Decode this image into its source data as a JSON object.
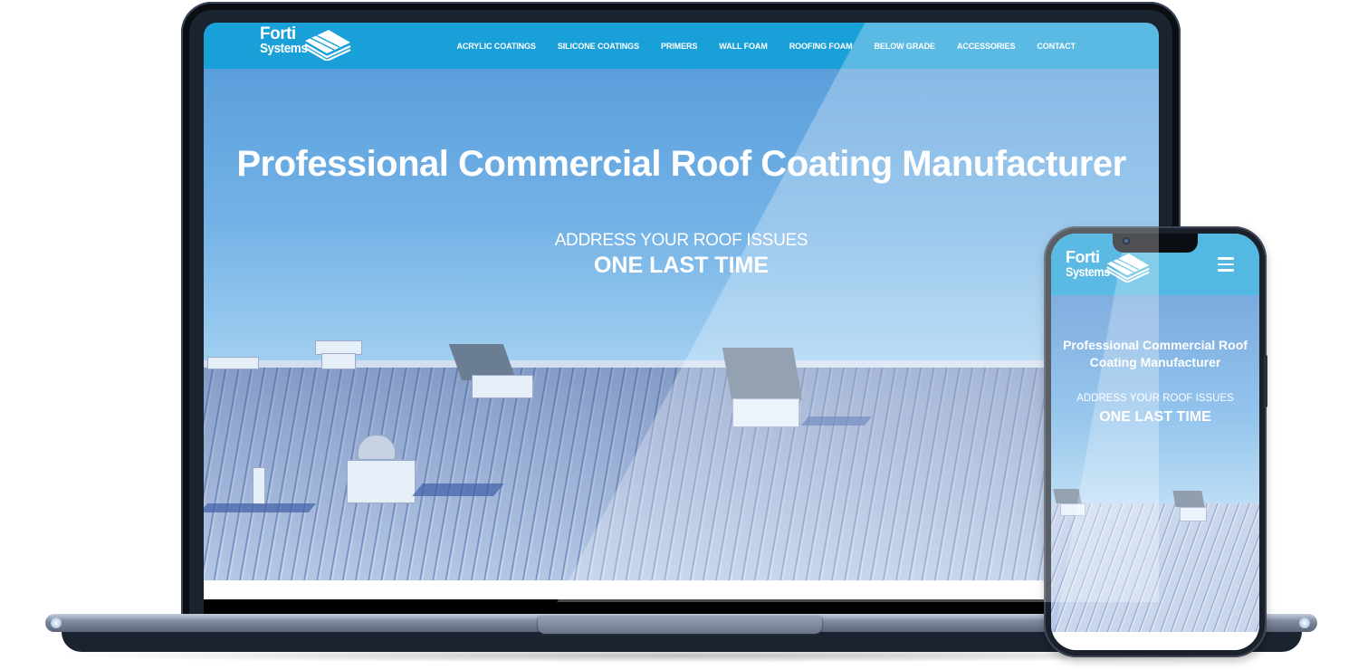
{
  "brand": {
    "name_line1": "Forti",
    "name_line2": "Systems",
    "primary_color": "#1aa0d8",
    "text_color": "#ffffff"
  },
  "desktop": {
    "nav": {
      "items": [
        {
          "label": "ACRYLIC COATINGS"
        },
        {
          "label": "SILICONE COATINGS"
        },
        {
          "label": "PRIMERS"
        },
        {
          "label": "WALL FOAM"
        },
        {
          "label": "ROOFING FOAM"
        },
        {
          "label": "BELOW GRADE"
        },
        {
          "label": "ACCESSORIES"
        },
        {
          "label": "CONTACT"
        }
      ]
    },
    "hero": {
      "title": "Professional Commercial Roof Coating Manufacturer",
      "subtitle_line1": "ADDRESS YOUR ROOF ISSUES",
      "subtitle_line2": "ONE LAST TIME"
    }
  },
  "mobile": {
    "menu_icon": "hamburger-icon",
    "hero": {
      "title_line1": "Professional Commercial Roof",
      "title_line2": "Coating Manufacturer",
      "subtitle_line1": "ADDRESS YOUR ROOF ISSUES",
      "subtitle_line2": "ONE LAST TIME"
    }
  }
}
